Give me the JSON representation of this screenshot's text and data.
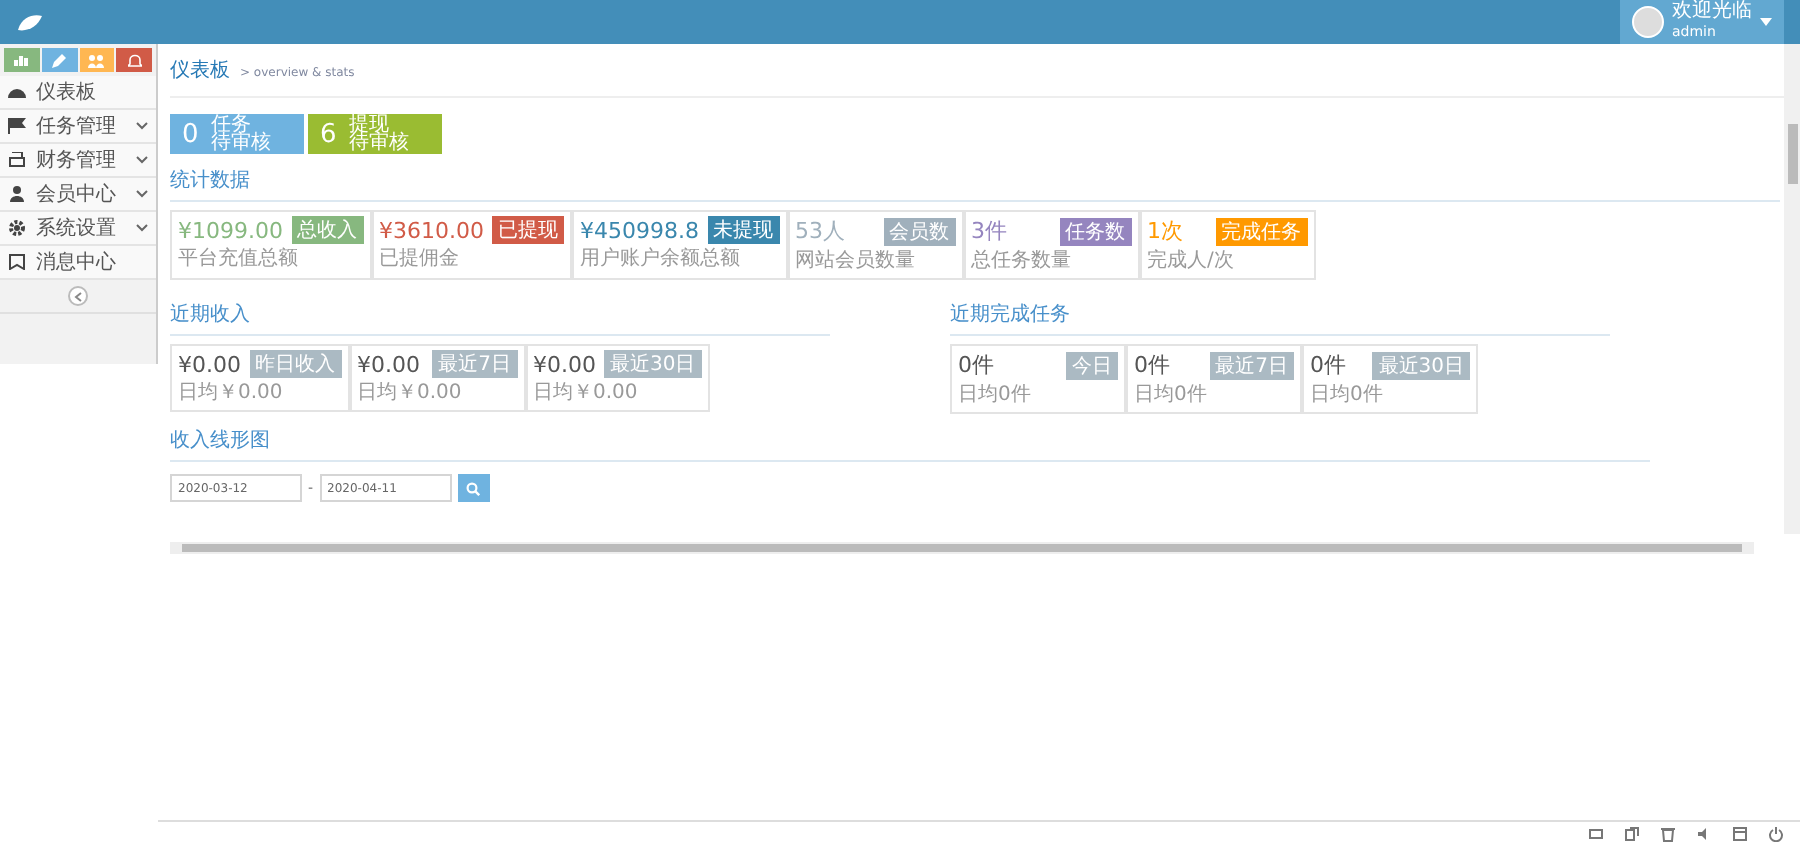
{
  "header": {
    "welcome": "欢迎光临",
    "user": "admin"
  },
  "sidebar": {
    "shortcuts": [
      {
        "kind": "chart",
        "color": "#87b87f"
      },
      {
        "kind": "pencil",
        "color": "#6fb3e0"
      },
      {
        "kind": "users",
        "color": "#ffb752"
      },
      {
        "kind": "bell",
        "color": "#d15b47"
      }
    ],
    "items": [
      {
        "label": "仪表板",
        "kind": "gauge",
        "expandable": false
      },
      {
        "label": "任务管理",
        "kind": "flag",
        "expandable": true
      },
      {
        "label": "财务管理",
        "kind": "print",
        "expandable": true
      },
      {
        "label": "会员中心",
        "kind": "user",
        "expandable": true
      },
      {
        "label": "系统设置",
        "kind": "gear",
        "expandable": true
      },
      {
        "label": "消息中心",
        "kind": "book",
        "expandable": false
      }
    ]
  },
  "breadcrumb": {
    "title": "仪表板",
    "subtitle": "> overview & stats"
  },
  "pending": [
    {
      "count": "0",
      "label": "任务",
      "sub": "待审核",
      "color": "#6fb3e0"
    },
    {
      "count": "6",
      "label": "提现",
      "sub": "待审核",
      "color": "#9abc32"
    }
  ],
  "stats": {
    "title": "统计数据",
    "items": [
      {
        "value": "¥1099.00",
        "label": "平台充值总额",
        "badge": "总收入",
        "color": "#87b87f"
      },
      {
        "value": "¥3610.00",
        "label": "已提佣金",
        "badge": "已提现",
        "color": "#d15b47"
      },
      {
        "value": "¥450998.8",
        "label": "用户账户余额总额",
        "badge": "未提现",
        "color": "#3a87ad"
      },
      {
        "value": "53人",
        "label": "网站会员数量",
        "badge": "会员数",
        "color": "#a0b0bc"
      },
      {
        "value": "3件",
        "label": "总任务数量",
        "badge": "任务数",
        "color": "#9585bf"
      },
      {
        "value": "1次",
        "label": "完成人/次",
        "badge": "完成任务",
        "color": "#ff9900"
      }
    ]
  },
  "income": {
    "title": "近期收入",
    "items": [
      {
        "value": "¥0.00",
        "sub": "日均￥0.00",
        "badge": "昨日收入"
      },
      {
        "value": "¥0.00",
        "sub": "日均￥0.00",
        "badge": "最近7日"
      },
      {
        "value": "¥0.00",
        "sub": "日均￥0.00",
        "badge": "最近30日"
      }
    ]
  },
  "tasks": {
    "title": "近期完成任务",
    "items": [
      {
        "value": "0件",
        "sub": "日均0件",
        "badge": "今日"
      },
      {
        "value": "0件",
        "sub": "日均0件",
        "badge": "最近7日"
      },
      {
        "value": "0件",
        "sub": "日均0件",
        "badge": "最近30日"
      }
    ]
  },
  "chart": {
    "title": "收入线形图",
    "from": "2020-03-12",
    "separator": "-",
    "to": "2020-04-11"
  }
}
